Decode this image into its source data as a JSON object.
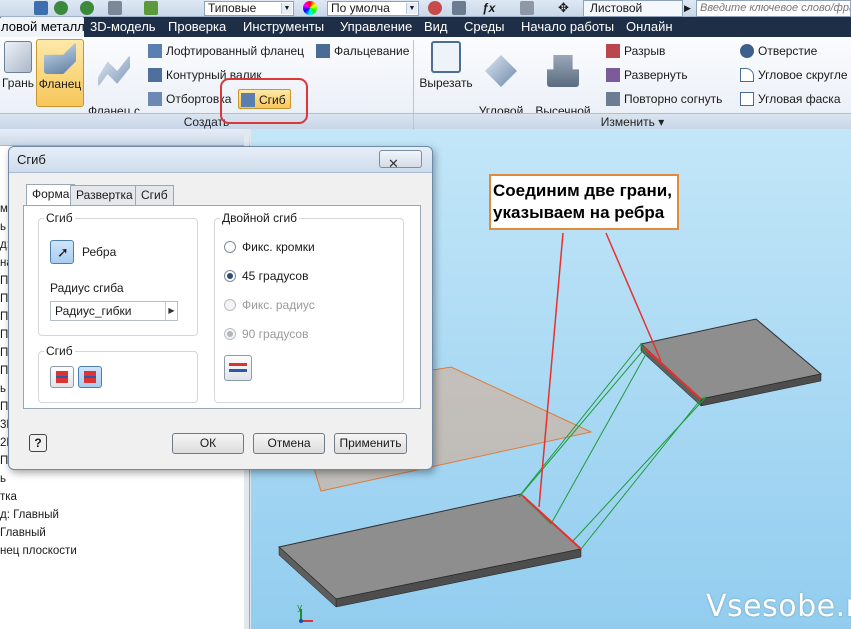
{
  "quick_access": {
    "style_combo": "Типовые",
    "material_combo": "По умолча",
    "document_title": "Листовой металл",
    "search_placeholder": "Введите ключевое слово/фразу"
  },
  "ribbon_tabs": [
    {
      "label": "ловой металл",
      "active": true
    },
    {
      "label": "3D-модель",
      "active": false
    },
    {
      "label": "Проверка",
      "active": false
    },
    {
      "label": "Инструменты",
      "active": false
    },
    {
      "label": "Управление",
      "active": false
    },
    {
      "label": "Вид",
      "active": false
    },
    {
      "label": "Среды",
      "active": false
    },
    {
      "label": "Начало работы",
      "active": false
    },
    {
      "label": "Онлайн",
      "active": false
    }
  ],
  "ribbon": {
    "create": {
      "face_label": "Грань",
      "flange_label": "Фланец",
      "contour_flange_label": "Фланец с\nотгибом",
      "lofted_flange": "Лофтированный фланец",
      "contour_roll": "Контурный валик",
      "hem": "Отбортовка",
      "bend": "Сгиб",
      "fold": "Фальцевание",
      "group_label": "Создать"
    },
    "modify": {
      "cut_label": "Вырезать",
      "corner_seam_label": "Угловой\nстык",
      "punch_tool_label": "Высечной\nинструмент",
      "rip": "Разрыв",
      "unfold": "Развернуть",
      "refold": "Повторно согнуть",
      "hole": "Отверстие",
      "corner_round": "Угловое скругле",
      "corner_chamfer": "Угловая фаска",
      "group_label": "Изменить ▾"
    }
  },
  "browser_fragments": [
    "ме",
    "ь",
    "д:",
    "на",
    "П",
    "П",
    "П",
    "П",
    "П",
    "П",
    "ь",
    "П",
    "3П",
    "2П",
    "П",
    "ь",
    "тка",
    "д: Главный",
    "Главный",
    "нец плоскости"
  ],
  "dialog": {
    "title": "Сгиб",
    "close_label": "✕",
    "tabs": [
      {
        "label": "Форма",
        "active": true
      },
      {
        "label": "Развертка",
        "active": false
      },
      {
        "label": "Сгиб",
        "active": false
      }
    ],
    "bend_group": {
      "title": "Сгиб",
      "edges_label": "Ребра",
      "radius_label": "Радиус сгиба",
      "radius_value": "Радиус_гибки"
    },
    "flip_group": {
      "title": "Сгиб"
    },
    "double_bend": {
      "title": "Двойной сгиб",
      "options": [
        {
          "label": "Фикс. кромки",
          "checked": false,
          "disabled": false
        },
        {
          "label": "45 градусов",
          "checked": true,
          "disabled": false
        },
        {
          "label": "Фикс. радиус",
          "checked": false,
          "disabled": true
        },
        {
          "label": "90 градусов",
          "checked": true,
          "disabled": true
        }
      ]
    },
    "help_label": "?",
    "ok_label": "ОК",
    "cancel_label": "Отмена",
    "apply_label": "Применить"
  },
  "callout": {
    "text": "Соединим две грани, указываем на ребра"
  },
  "watermark": "Vsesobe.ru",
  "colors": {
    "ribbon_dark": "#1d2e46",
    "highlight": "#d9383a",
    "callout_border": "#e08a3a",
    "viewport_top": "#c3e6f8"
  }
}
